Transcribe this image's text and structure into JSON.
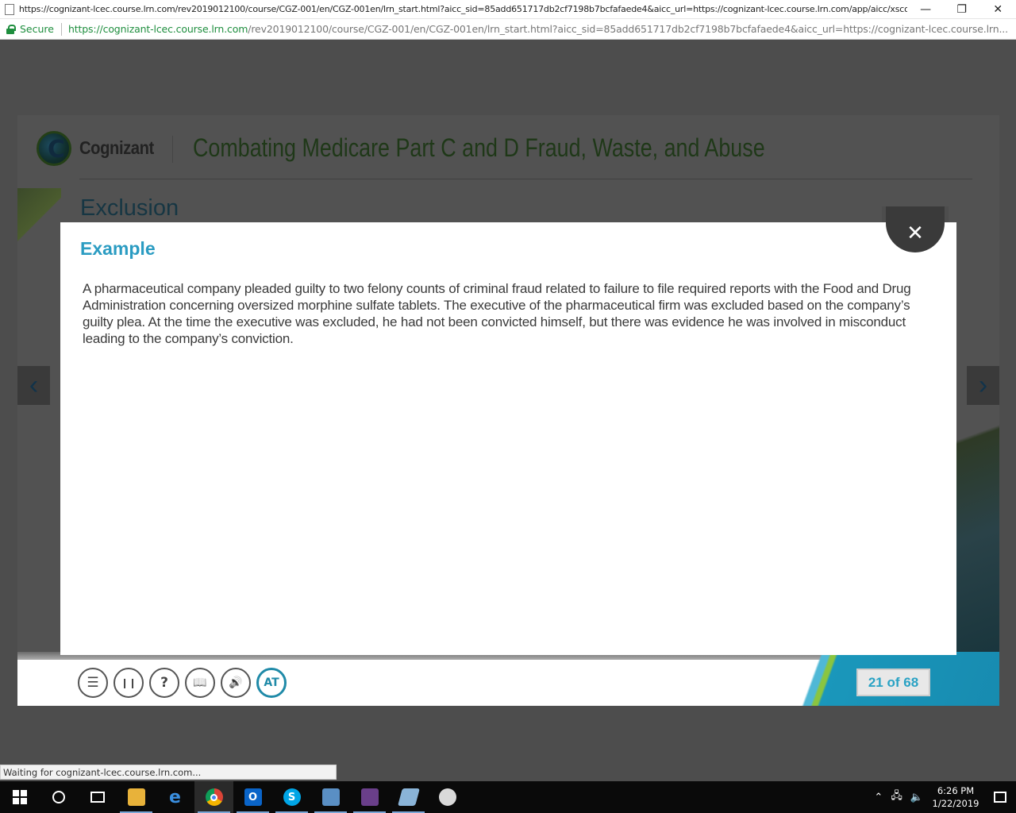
{
  "window": {
    "title": "https://cognizant-lcec.course.lrn.com/rev2019012100/course/CGZ-001/en/CGZ-001en/lrn_start.html?aicc_sid=85add651717db2cf7198b7bcfafaede4&aicc_url=https://cognizant-lcec.course.lrn.com/app/aicc/xsco...",
    "minimize": "—",
    "restore": "❐",
    "close": "✕"
  },
  "address": {
    "secure_label": "Secure",
    "url_host": "https://cognizant-lcec.course.lrn.com",
    "url_rest": "/rev2019012100/course/CGZ-001/en/CGZ-001en/lrn_start.html?aicc_sid=85add651717db2cf7198b7bcfafaede4&aicc_url=https://cognizant-lcec.course.lrn..."
  },
  "course": {
    "brand": "Cognizant",
    "title": "Combating Medicare Part C and D Fraud, Waste, and Abuse",
    "section_title": "Exclusion",
    "page_counter": "21 of 68",
    "controls": [
      {
        "name": "menu-button",
        "icon": "list-icon",
        "glyph": "☰"
      },
      {
        "name": "pause-button",
        "icon": "pause-icon",
        "glyph": "❙❙"
      },
      {
        "name": "help-button",
        "icon": "help-icon",
        "glyph": "?"
      },
      {
        "name": "glossary-button",
        "icon": "book-icon",
        "glyph": "📖"
      },
      {
        "name": "audio-button",
        "icon": "speaker-icon",
        "glyph": "🔊"
      },
      {
        "name": "text-size-button",
        "icon": "text-size-icon",
        "glyph": "AT"
      }
    ]
  },
  "modal": {
    "title": "Example",
    "body": "A pharmaceutical company pleaded guilty to two felony counts of criminal fraud related to failure to file required reports with the Food and Drug Administration concerning oversized morphine sulfate tablets. The executive of the pharmaceutical firm was excluded based on the company’s guilty plea. At the time the executive was excluded, he had not been convicted himself, but there was evidence he was involved in misconduct leading to the company’s conviction.",
    "close_glyph": "✕"
  },
  "status": {
    "text": "Waiting for cognizant-lcec.course.lrn.com..."
  },
  "taskbar": {
    "time": "6:26 PM",
    "date": "1/22/2019"
  },
  "colors": {
    "accent": "#2b9cc2",
    "secure": "#1e8e3e",
    "modal_bg": "#ffffff",
    "overlay": "#4d4d4d"
  }
}
